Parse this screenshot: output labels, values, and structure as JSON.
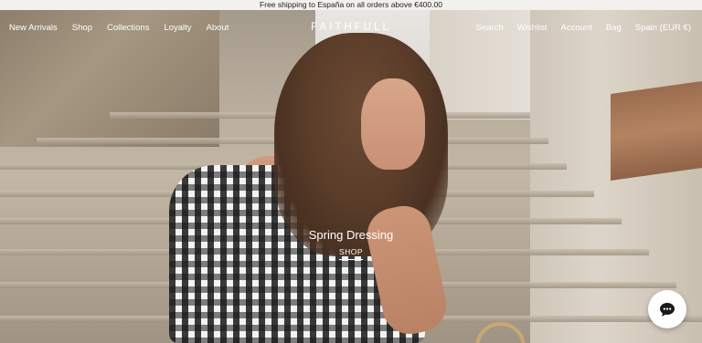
{
  "announcement": {
    "text": "Free shipping to España on all orders above €400.00"
  },
  "header": {
    "nav_left": [
      {
        "label": "New Arrivals"
      },
      {
        "label": "Shop"
      },
      {
        "label": "Collections"
      },
      {
        "label": "Loyalty"
      },
      {
        "label": "About"
      }
    ],
    "logo": "FAITHFULL",
    "nav_right": [
      {
        "label": "Search"
      },
      {
        "label": "Wishlist"
      },
      {
        "label": "Account"
      },
      {
        "label": "Bag"
      },
      {
        "label": "Spain (EUR €)"
      }
    ]
  },
  "hero": {
    "title": "Spring Dressing",
    "cta_label": "SHOP"
  },
  "chat": {
    "icon": "chat-bubble-icon"
  },
  "colors": {
    "header_text": "#ffffff",
    "announcement_bg": "#f3f1ed",
    "chat_button_bg": "#ffffff",
    "chat_icon": "#1a1a1a"
  }
}
